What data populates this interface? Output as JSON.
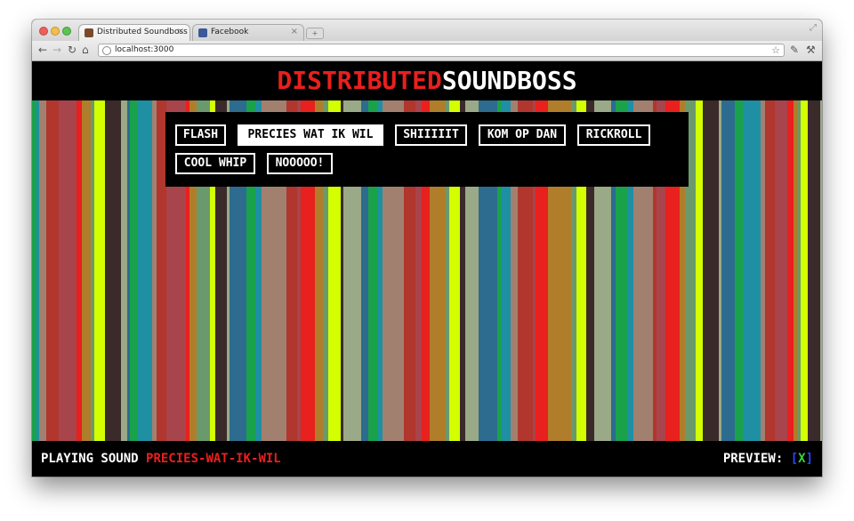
{
  "browser": {
    "tabs": [
      {
        "title": "Distributed Soundboss",
        "active": true,
        "icon": "soundboss-favicon"
      },
      {
        "title": "Facebook",
        "active": false,
        "icon": "facebook-favicon"
      }
    ],
    "url": "localhost:3000"
  },
  "app": {
    "title_part1": "DISTRIBUTED",
    "title_part2": "SOUNDBOSS",
    "colors": {
      "accent_red": "#e8201e",
      "preview_bracket": "#2448ff",
      "preview_x": "#39d23a"
    }
  },
  "sounds": [
    {
      "label": "FLASH",
      "active": false
    },
    {
      "label": "PRECIES WAT IK WIL",
      "active": true
    },
    {
      "label": "SHIIIIIT",
      "active": false
    },
    {
      "label": "KOM OP DAN",
      "active": false
    },
    {
      "label": "RICKROLL",
      "active": false
    },
    {
      "label": "COOL WHIP",
      "active": false
    },
    {
      "label": "NOOOOO!",
      "active": false
    }
  ],
  "status": {
    "playing_label": "PLAYING SOUND",
    "current_sound": "PRECIES-WAT-IK-WIL",
    "preview_label": "PREVIEW:",
    "preview_open": "[",
    "preview_x": "X",
    "preview_close": "]"
  },
  "stripe_colors": [
    "#3b2a2a",
    "#a2806f",
    "#6a9a6b",
    "#1aa24b",
    "#e8201e",
    "#9aa987",
    "#b0362e",
    "#d3ff00",
    "#1f8fa3",
    "#b07e2a",
    "#2d6b8f",
    "#a8444b"
  ]
}
